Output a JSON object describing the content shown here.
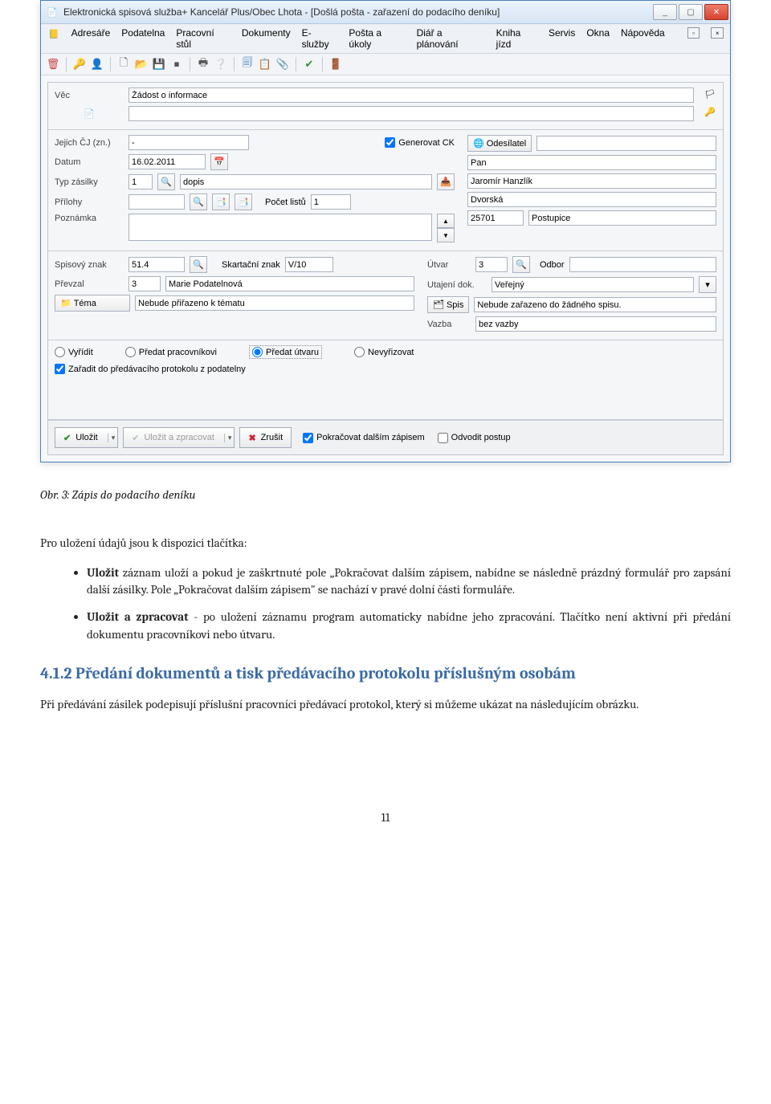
{
  "window": {
    "title": "Elektronická spisová služba+ Kancelář Plus/Obec Lhota - [Došlá pošta - zařazení do podacího deníku]"
  },
  "menu": [
    "Adresáře",
    "Podatelna",
    "Pracovní stůl",
    "Dokumenty",
    "E-služby",
    "Pošta a úkoly",
    "Diář a plánování",
    "Kniha jízd",
    "Servis",
    "Okna",
    "Nápověda"
  ],
  "form": {
    "vec_label": "Věc",
    "vec_value": "Žádost o informace",
    "jejich_cj_label": "Jejich ČJ (zn.)",
    "jejich_cj_value": "-",
    "generovat_ck_label": "Generovat CK",
    "generovat_ck_checked": true,
    "odesilatel_label": "Odesílatel",
    "datum_label": "Datum",
    "datum_value": "16.02.2011",
    "typ_label": "Typ zásilky",
    "typ_num": "1",
    "typ_value": "dopis",
    "prilohy_label": "Přílohy",
    "pocet_listu_label": "Počet listů",
    "pocet_listu_value": "1",
    "poznamka_label": "Poznámka",
    "psc_value": "25701",
    "odesilatel_pan": "Pan",
    "odesilatel_jmeno": "Jaromír Hanzlík",
    "odesilatel_ulice": "Dvorská",
    "odesilatel_obec": "Postupice",
    "spisovy_znak_label": "Spisový znak",
    "spisovy_znak_value": "51.4",
    "skartacni_znak_label": "Skartační znak",
    "skartacni_znak_value": "V/10",
    "utvar_label": "Útvar",
    "utvar_value": "3",
    "odbor_label": "Odbor",
    "prevzal_label": "Převzal",
    "prevzal_num": "3",
    "prevzal_value": "Marie Podatelnová",
    "utajeni_label": "Utajení dok.",
    "utajeni_value": "Veřejný",
    "tema_label": "Téma",
    "tema_value": "Nebude přiřazeno k tématu",
    "spis_label": "Spis",
    "spis_value": "Nebude zařazeno do žádného spisu.",
    "vazba_label": "Vazba",
    "vazba_value": "bez vazby",
    "radio_vyridit": "Vyřídit",
    "radio_predat_prac": "Předat pracovníkovi",
    "radio_predat_utvaru": "Předat útvaru",
    "radio_nevyrizovat": "Nevyřizovat",
    "chk_zaradit": "Zařadit do předávacího protokolu z podatelny"
  },
  "buttons": {
    "ulozit": "Uložit",
    "ulozit_zpracovat": "Uložit a zpracovat",
    "zrusit": "Zrušit",
    "pokracovat": "Pokračovat dalším zápisem",
    "odvodit": "Odvodit postup"
  },
  "doc": {
    "caption": "Obr. 3: Zápis do podacího deníku",
    "intro": "Pro uložení údajů jsou k dispozici tlačítka:",
    "b1_lead": "Uložit",
    "b1_text": " záznam uloží a pokud je zaškrtnuté pole „Pokračovat dalším zápisem, nabídne se následně prázdný formulář pro zapsání další zásilky. Pole „Pokračovat dalším zápisem\" se nachází v pravé dolní části formuláře.",
    "b2_lead": "Uložit a zpracovat",
    "b2_text": " - po uložení záznamu program automaticky nabídne jeho zpracování. Tlačítko není aktivní při předání dokumentu pracovníkovi nebo útvaru.",
    "section_num": "4.1.2",
    "section_title": "Předání dokumentů a tisk předávacího protokolu příslušným osobám",
    "para": "Při předávání zásilek podepisují příslušní pracovníci předávací protokol, který si můžeme ukázat na následujícím obrázku.",
    "pagenum": "11"
  }
}
